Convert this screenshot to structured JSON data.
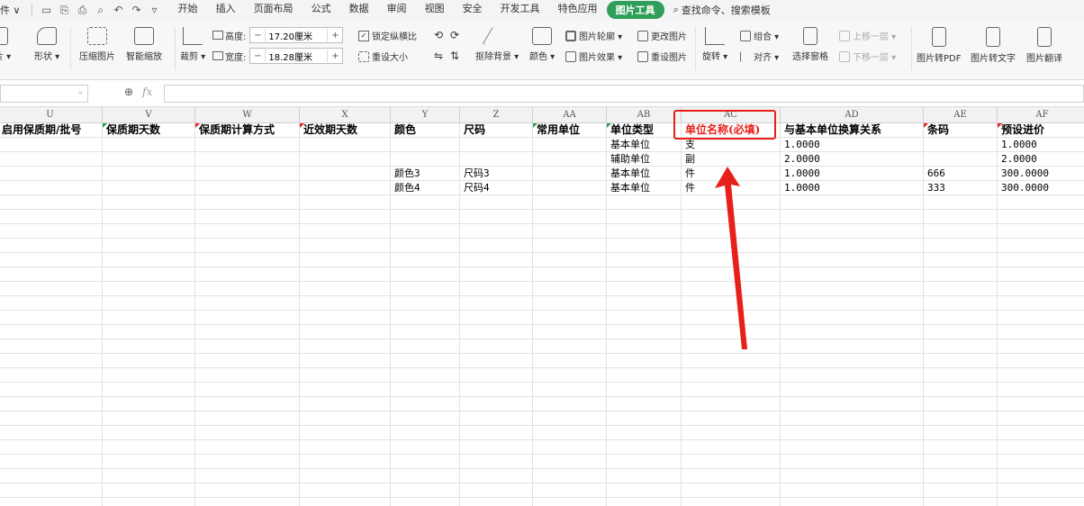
{
  "menubar": {
    "file_menu": "件 ∨",
    "tabs": [
      "开始",
      "插入",
      "页面布局",
      "公式",
      "数据",
      "审阅",
      "视图",
      "安全",
      "开发工具",
      "特色应用",
      "图片工具"
    ],
    "active_tab": "图片工具",
    "search_text": "查找命令、搜索模板"
  },
  "ribbon": {
    "left_partial": "片 ▾",
    "shape": "形状 ▾",
    "compress": "压缩图片",
    "smart_zoom": "智能缩放",
    "crop": "裁剪 ▾",
    "height_label": "高度:",
    "height_value": "17.20厘米",
    "width_label": "宽度:",
    "width_value": "18.28厘米",
    "lock_ratio": "锁定纵横比",
    "reset_size": "重设大小",
    "remove_bg": "抠除背景 ▾",
    "color": "颜色 ▾",
    "outline": "图片轮廓 ▾",
    "effect": "图片效果 ▾",
    "change_pic": "更改图片",
    "reset_pic": "重设图片",
    "rotate": "旋转 ▾",
    "group": "组合 ▾",
    "align": "对齐 ▾",
    "selection_pane": "选择窗格",
    "bring_forward": "上移一层 ▾",
    "send_backward": "下移一层 ▾",
    "to_pdf": "图片转PDF",
    "to_text": "图片转文字",
    "translate": "图片翻译"
  },
  "formula": {
    "name_value": "",
    "formula_value": ""
  },
  "columns": [
    {
      "letter": "U",
      "header": "启用保质期/批号"
    },
    {
      "letter": "V",
      "header": "保质期天数"
    },
    {
      "letter": "W",
      "header": "保质期计算方式"
    },
    {
      "letter": "X",
      "header": "近效期天数"
    },
    {
      "letter": "Y",
      "header": "颜色"
    },
    {
      "letter": "Z",
      "header": "尺码"
    },
    {
      "letter": "AA",
      "header": "常用单位"
    },
    {
      "letter": "AB",
      "header": "单位类型"
    },
    {
      "letter": "AC",
      "header": "单位名称(必填)"
    },
    {
      "letter": "AD",
      "header": "与基本单位换算关系"
    },
    {
      "letter": "AE",
      "header": "条码"
    },
    {
      "letter": "AF",
      "header": "预设进价"
    }
  ],
  "rows": [
    [
      "",
      "",
      "",
      "",
      "",
      "",
      "",
      "基本单位",
      "支",
      "1.0000",
      "",
      "1.0000"
    ],
    [
      "",
      "",
      "",
      "",
      "",
      "",
      "",
      "辅助单位",
      "副",
      "2.0000",
      "",
      "2.0000"
    ],
    [
      "",
      "",
      "",
      "",
      "颜色3",
      "尺码3",
      "",
      "基本单位",
      "件",
      "1.0000",
      "666",
      "300.0000"
    ],
    [
      "",
      "",
      "",
      "",
      "颜色4",
      "尺码4",
      "",
      "基本单位",
      "件",
      "1.0000",
      "333",
      "300.0000"
    ]
  ],
  "colors": {
    "accent_green": "#2f9e58",
    "required_red": "#e8201b"
  }
}
